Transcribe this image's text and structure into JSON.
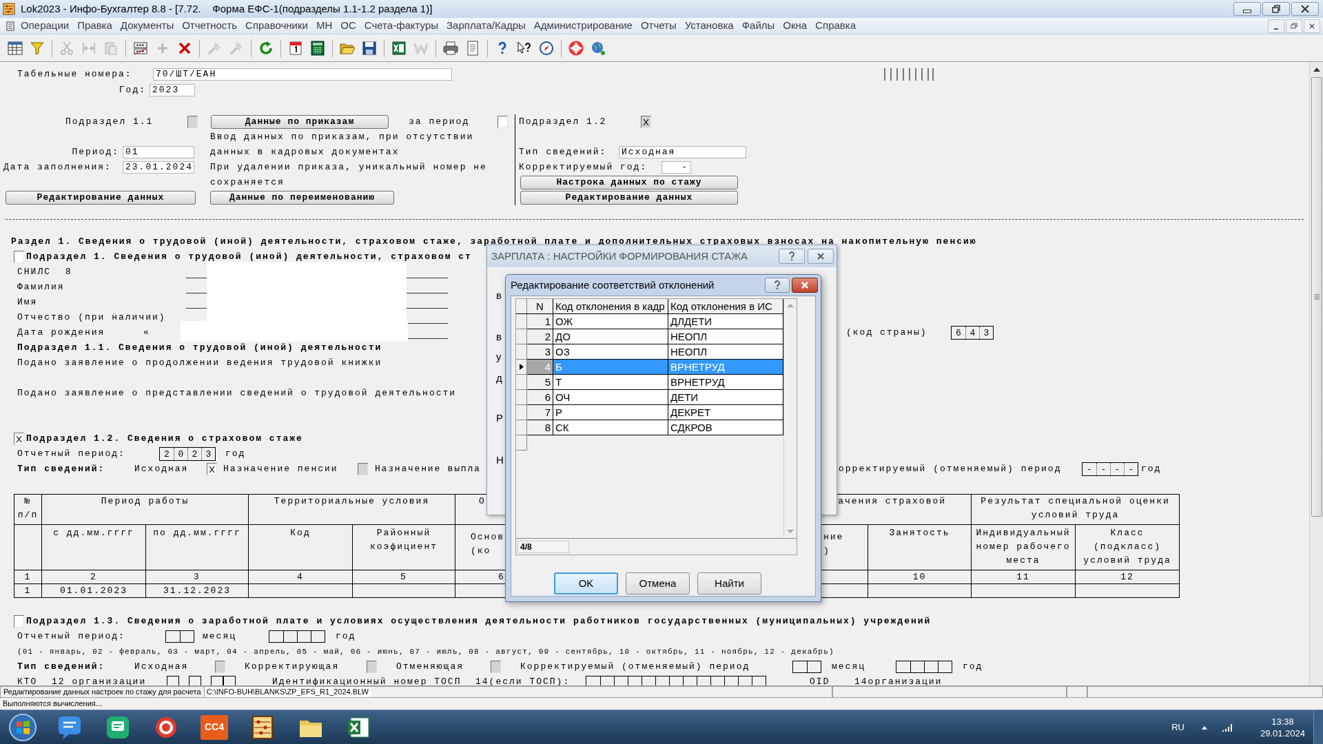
{
  "window": {
    "title": "Lok2023 - Инфо-Бухгалтер 8.8 - [7.72.    Форма ЕФС-1(подразделы 1.1-1.2 раздела 1)]"
  },
  "menu": [
    {
      "label": "Операции"
    },
    {
      "label": "Правка"
    },
    {
      "label": "Документы"
    },
    {
      "label": "Отчетность"
    },
    {
      "label": "Справочники"
    },
    {
      "label": "МН"
    },
    {
      "label": "ОС"
    },
    {
      "label": "Счета-фактуры"
    },
    {
      "label": "Зарплата/Кадры"
    },
    {
      "label": "Администрирование"
    },
    {
      "label": "Отчеты"
    },
    {
      "label": "Установка"
    },
    {
      "label": "Файлы"
    },
    {
      "label": "Окна"
    },
    {
      "label": "Справка"
    }
  ],
  "toolbar": [
    {
      "kind": "grid",
      "disabled": false
    },
    {
      "kind": "filter",
      "disabled": false
    },
    {
      "kind": "separator"
    },
    {
      "kind": "cut",
      "disabled": true
    },
    {
      "kind": "split",
      "disabled": true
    },
    {
      "kind": "paste",
      "disabled": true
    },
    {
      "kind": "separator"
    },
    {
      "kind": "counter",
      "disabled": false
    },
    {
      "kind": "add",
      "disabled": true
    },
    {
      "kind": "delete",
      "disabled": false
    },
    {
      "kind": "separator"
    },
    {
      "kind": "wand",
      "disabled": true
    },
    {
      "kind": "wand",
      "disabled": true
    },
    {
      "kind": "separator"
    },
    {
      "kind": "refresh",
      "disabled": false
    },
    {
      "kind": "separator"
    },
    {
      "kind": "calendar",
      "disabled": false
    },
    {
      "kind": "calculator",
      "disabled": false
    },
    {
      "kind": "separator"
    },
    {
      "kind": "open",
      "disabled": false
    },
    {
      "kind": "save",
      "disabled": false
    },
    {
      "kind": "separator"
    },
    {
      "kind": "excel",
      "disabled": false
    },
    {
      "kind": "word",
      "disabled": true
    },
    {
      "kind": "separator"
    },
    {
      "kind": "print",
      "disabled": false
    },
    {
      "kind": "document",
      "disabled": false
    },
    {
      "kind": "separator"
    },
    {
      "kind": "help",
      "disabled": false
    },
    {
      "kind": "context-help",
      "disabled": false
    },
    {
      "kind": "compass",
      "disabled": false
    },
    {
      "kind": "separator"
    },
    {
      "kind": "lifebuoy",
      "disabled": false
    },
    {
      "kind": "globe",
      "disabled": false
    }
  ],
  "form": {
    "tab_numbers": {
      "label": "Табельные номера:",
      "value": "70/ШТ/ЕАН"
    },
    "year": {
      "label": "Год:",
      "value": "2023"
    },
    "left_panel": {
      "subsection": {
        "label": "Подраздел 1.1",
        "checked": false,
        "disabled": true
      },
      "orders_button": "Данные по приказам",
      "for_period": {
        "label": "за период",
        "checked": false,
        "disabled": false
      },
      "notes": [
        "Ввод данных по приказам, при отсутствии данных в кадровых документах",
        "При удалении приказа, уникальный номер не сохраняется"
      ],
      "period": {
        "label": "Период:",
        "value": "01"
      },
      "fill_date": {
        "label": "Дата заполнения:",
        "value": "23.01.2024"
      },
      "buttons": [
        "Редактирование данных",
        "Данные по переименованию"
      ]
    },
    "right_panel": {
      "subsection": {
        "label": "Подраздел 1.2",
        "checked": true,
        "disabled": true
      },
      "info_type": {
        "label": "Тип сведений:",
        "value": "Исходная"
      },
      "corrected_year": {
        "label": "Корректируемый год:",
        "value": "-"
      },
      "buttons": [
        "Настрока данных по стажу",
        "Редактирование данных"
      ]
    }
  },
  "section_1": {
    "heading": "Раздел 1. Сведения о трудовой (иной) деятельности, страховом стаже, заработной плате и дополнительных страховых взносах на накопительную пенсию",
    "subsection_1": {
      "label": "Подраздел 1. Сведения о трудовой (иной) деятельности, страховом ст",
      "checked": false
    },
    "person": [
      {
        "label": "СНИЛС",
        "value": "8"
      },
      {
        "label": "Фамилия"
      },
      {
        "label": "Имя"
      },
      {
        "label": "Отчество (при наличии)"
      },
      {
        "label": "Дата рождения",
        "value": "«"
      }
    ],
    "country_code": {
      "label": "(код страны)",
      "digits": [
        "6",
        "4",
        "3"
      ]
    },
    "subsection_1_1": {
      "heading": "Подраздел 1.1. Сведения о трудовой (иной) деятельности",
      "statements": [
        "Подано заявление о продолжении ведения трудовой книжки",
        "Подано заявление о представлении сведений о трудовой деятельности"
      ]
    },
    "subsection_1_2": {
      "label": "Подраздел 1.2. Сведения о страховом стаже",
      "checked": true,
      "reporting_period": {
        "label": "Отчетный период:",
        "digits": [
          "2",
          "0",
          "2",
          "3"
        ],
        "unit": "год"
      },
      "info_type": {
        "label": "Тип сведений:",
        "value": "Исходная",
        "options": [
          {
            "label": "Назначение пенсии",
            "checked": true,
            "disabled": false
          },
          {
            "label": "Назначение выпла",
            "checked": false,
            "disabled": true
          }
        ]
      },
      "corrected_period": {
        "label": "орректируемый (отменяемый) период",
        "digits": [
          "-",
          "-",
          "-",
          "-"
        ],
        "unit": "год"
      }
    },
    "table": {
      "header_groups": [
        {
          "text": "№ п/п"
        },
        {
          "text": "Период работы"
        },
        {
          "text": "Территориальные условия"
        },
        {
          "text": "О"
        },
        {
          "text": "ачения страховой"
        },
        {
          "text": "Результат специальной оценки условий труда"
        }
      ],
      "columns": [
        "",
        "с дд.мм.гггг",
        "по дд.мм.гггг",
        "Код",
        "Районный коэфициент",
        "Основ (ко",
        null,
        null,
        "ние )",
        "Занятость",
        "Индивидуальный номер рабочего места",
        "Класс (подкласс) условий труда"
      ],
      "rows": [
        [
          "1",
          "2",
          "3",
          "4",
          "5",
          "6",
          null,
          null,
          null,
          "10",
          "11",
          "12"
        ],
        [
          "1",
          "01.01.2023",
          "31.12.2023",
          null,
          null,
          null,
          null,
          null,
          null,
          null,
          null,
          null
        ]
      ]
    },
    "subsection_1_3": {
      "label": "Подраздел 1.3. Сведения о заработной плате и условиях осуществления деятельности работников государственных (муниципальных) учреждений",
      "checked": false,
      "reporting_period": {
        "label": "Отчетный период:",
        "month_unit": "месяц",
        "year_unit": "год"
      },
      "months_legend": "(01 - январь, 02 - февраль, 03 - март, 04 - апрель, 05 - май, 06 - июнь, 07 - июль, 08 - август, 09 - сентябрь, 10 - октябрь, 11 - ноябрь, 12 - декабрь)",
      "info_type": {
        "label": "Тип сведений:",
        "options": [
          {
            "label": "Исходная",
            "checked": false,
            "disabled": true
          },
          {
            "label": "Корректирующая",
            "checked": false,
            "disabled": true
          },
          {
            "label": "Отменяющая",
            "checked": false,
            "disabled": true
          }
        ],
        "corrected_period": {
          "label": "Корректируемый (отменяемый) период",
          "month_unit": "месяц",
          "year_unit": "год"
        }
      },
      "kto": {
        "label": "КТО",
        "code_label": "12 организации",
        "tosp_label": "Идентификационный номер ТОСП",
        "tosp_hint": "14(если ТОСП):",
        "oid_label": "OID",
        "oid_hint": "14организации"
      }
    }
  },
  "settings_dialog": {
    "title": "ЗАРПЛАТА : НАСТРОЙКИ ФОРМИРОВАНИЯ СТАЖА",
    "fragments": [
      "в",
      "в",
      "у",
      "д",
      "Р",
      "Н"
    ]
  },
  "mapping_dialog": {
    "title": "Редактирование соответствий отклонений",
    "columns": [
      "N",
      "Код отклонения в кадр",
      "Код отклонения в ИС"
    ],
    "rows": [
      {
        "n": "1",
        "hr_code": "ОЖ",
        "is_code": "ДЛДЕТИ",
        "selected": false
      },
      {
        "n": "2",
        "hr_code": "ДО",
        "is_code": "НЕОПЛ",
        "selected": false
      },
      {
        "n": "3",
        "hr_code": "ОЗ",
        "is_code": "НЕОПЛ",
        "selected": false
      },
      {
        "n": "4",
        "hr_code": "Б",
        "is_code": "ВРНЕТРУД",
        "selected": true
      },
      {
        "n": "5",
        "hr_code": "Т",
        "is_code": "ВРНЕТРУД",
        "selected": false
      },
      {
        "n": "6",
        "hr_code": "ОЧ",
        "is_code": "ДЕТИ",
        "selected": false
      },
      {
        "n": "7",
        "hr_code": "Р",
        "is_code": "ДЕКРЕТ",
        "selected": false
      },
      {
        "n": "8",
        "hr_code": "СК",
        "is_code": "СДКРОВ",
        "selected": false
      }
    ],
    "position": "4/8",
    "buttons": [
      {
        "label": "OK",
        "default": true
      },
      {
        "label": "Отмена",
        "default": false
      },
      {
        "label": "Найти",
        "default": false
      }
    ]
  },
  "status_bar": {
    "hint": "Редактирование данных настроек по стажу для расчета",
    "path": "C:\\INFO-BUH\\BLANKS\\ZP_EFS_R1_2024.BLW",
    "message": "Выполняются вычисления..."
  },
  "taskbar": {
    "apps": [
      {
        "kind": "messages"
      },
      {
        "kind": "chat"
      },
      {
        "kind": "red-app"
      },
      {
        "kind": "tile",
        "label": "CC4"
      },
      {
        "kind": "abacus"
      },
      {
        "kind": "folder"
      },
      {
        "kind": "excel"
      }
    ],
    "language": "RU",
    "time": "13:38",
    "date": "29.01.2024"
  }
}
